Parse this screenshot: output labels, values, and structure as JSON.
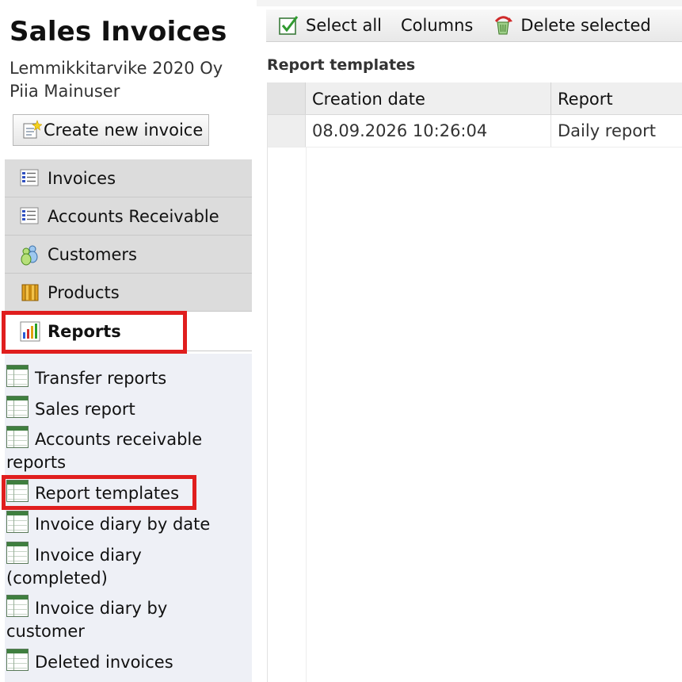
{
  "app": {
    "title": "Sales Invoices",
    "company": "Lemmikkitarvike 2020 Oy",
    "user": "Piia Mainuser",
    "create_button": "Create new invoice"
  },
  "nav": {
    "items": [
      {
        "label": "Invoices",
        "icon": "invoice-list-icon"
      },
      {
        "label": "Accounts Receivable",
        "icon": "invoice-list-icon"
      },
      {
        "label": "Customers",
        "icon": "users-icon"
      },
      {
        "label": "Products",
        "icon": "box-icon"
      },
      {
        "label": "Reports",
        "icon": "bar-chart-icon",
        "active": true
      }
    ]
  },
  "reports_menu": {
    "items": [
      {
        "label": "Transfer reports"
      },
      {
        "label": "Sales report"
      },
      {
        "label": "Accounts receivable reports"
      },
      {
        "label": "Report templates",
        "highlighted": true
      },
      {
        "label": "Invoice diary by date"
      },
      {
        "label": "Invoice diary (completed)"
      },
      {
        "label": "Invoice diary by customer"
      },
      {
        "label": "Deleted invoices"
      }
    ]
  },
  "toolbar": {
    "select_all": "Select all",
    "columns": "Columns",
    "delete_selected": "Delete selected"
  },
  "main": {
    "section_title": "Report templates",
    "table": {
      "columns": [
        "Creation date",
        "Report"
      ],
      "rows": [
        {
          "creation_date": "08.09.2026 10:26:04",
          "report": "Daily report"
        }
      ]
    }
  },
  "colors": {
    "highlight": "#e01e1e",
    "nav_background": "#dcdcdc",
    "submenu_background": "#eef0f6"
  }
}
